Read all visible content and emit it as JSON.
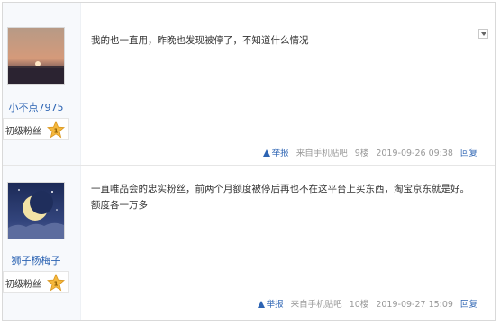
{
  "posts": [
    {
      "username": "小不点7975",
      "badge_label": "初级粉丝",
      "badge_level": "1",
      "content": "我的也一直用，昨晚也发现被停了，不知道什么情况",
      "report_label": "举报",
      "source": "来自手机贴吧",
      "floor": "9楼",
      "timestamp": "2019-09-26 09:38",
      "reply_label": "回复",
      "avatar_icon": "sunset-photo"
    },
    {
      "username": "狮子杨梅子",
      "badge_label": "初级粉丝",
      "badge_level": "1",
      "content": "一直唯品会的忠实粉丝，前两个月额度被停后再也不在这平台上买东西，淘宝京东就是好。\n额度各一万多",
      "report_label": "举报",
      "source": "来自手机贴吧",
      "floor": "10楼",
      "timestamp": "2019-09-27 15:09",
      "reply_label": "回复",
      "avatar_icon": "crescent-moon-photo"
    }
  ],
  "colors": {
    "link": "#2d64b3",
    "meta": "#999999",
    "badge_gold": "#f5b83d"
  }
}
